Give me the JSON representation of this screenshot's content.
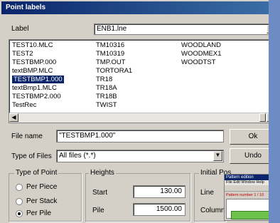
{
  "window": {
    "title": "Point labels"
  },
  "label_row": {
    "label": "Label",
    "value": "ENB1.lne"
  },
  "file_list": [
    {
      "c1": "TEST10.MLC",
      "c2": "TM10316",
      "c3": "WOODLAND"
    },
    {
      "c1": "TEST2",
      "c2": "TM10319",
      "c3": "WOODMEX1"
    },
    {
      "c1": "TESTBMP.000",
      "c2": "TMP.OUT",
      "c3": "WOODTST"
    },
    {
      "c1": "textBMP.MLC",
      "c2": "TORTORA1",
      "c3": ""
    },
    {
      "c1": "TESTBMP1.000",
      "c2": "TR18",
      "c3": "",
      "selected": true
    },
    {
      "c1": "textBmp1.MLC",
      "c2": "TR18A",
      "c3": ""
    },
    {
      "c1": "TESTBMP2.000",
      "c2": "TR18B",
      "c3": ""
    },
    {
      "c1": "TestRec",
      "c2": "TWIST",
      "c3": ""
    }
  ],
  "file_name": {
    "label": "File name",
    "value": "\"TESTBMP1.000\""
  },
  "file_type": {
    "label": "Type of Files",
    "value": "All files (*.*)"
  },
  "buttons": {
    "ok": "Ok",
    "undo": "Undo"
  },
  "type_of_point": {
    "title": "Type of Point",
    "options": [
      {
        "label": "Per Piece",
        "selected": false
      },
      {
        "label": "Per Stack",
        "selected": false
      },
      {
        "label": "Per Pile",
        "selected": true
      }
    ]
  },
  "heights": {
    "title": "Heights",
    "start_label": "Start",
    "start_value": "130.00",
    "pile_label": "Pile",
    "pile_value": "1500.00"
  },
  "initial_pos": {
    "title": "Initial Pos",
    "line_label": "Line",
    "column_label": "Column"
  },
  "thumbnail": {
    "title": "Pattern edition",
    "menu": "File Edit Window Help",
    "status": "Pattern number 1 / 10"
  }
}
